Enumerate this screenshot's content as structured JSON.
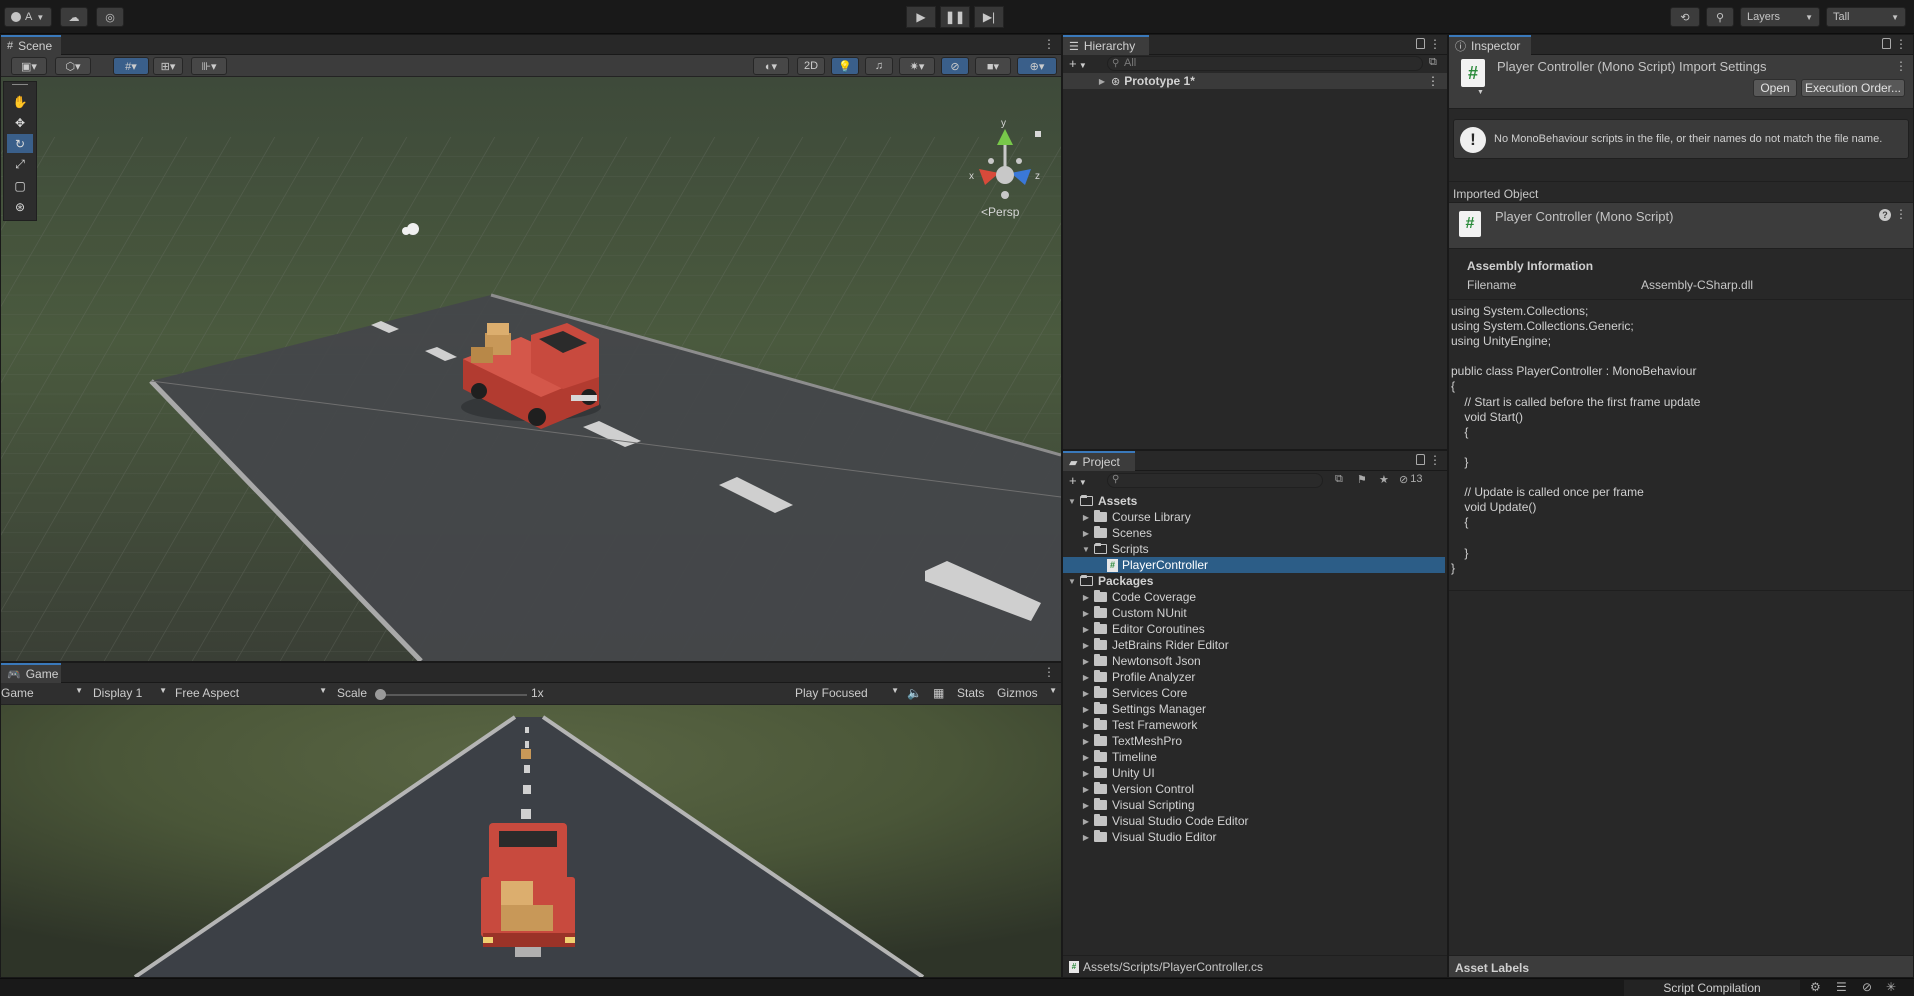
{
  "toolbar": {
    "account_label": "A",
    "layers_label": "Layers",
    "layout_label": "Tall"
  },
  "scene": {
    "tab_label": "Scene",
    "btn_2d": "2D",
    "persp_label": "Persp",
    "axis_x": "x",
    "axis_y": "y",
    "axis_z": "z"
  },
  "game": {
    "tab_label": "Game",
    "view_select": "Game",
    "display_select": "Display 1",
    "aspect_select": "Free Aspect",
    "scale_label": "Scale",
    "scale_value": "1x",
    "play_mode": "Play Focused",
    "stats_label": "Stats",
    "gizmos_label": "Gizmos"
  },
  "hierarchy": {
    "tab_label": "Hierarchy",
    "search_placeholder": "All",
    "items": [
      "Prototype 1*"
    ]
  },
  "project": {
    "tab_label": "Project",
    "hidden_count": "13",
    "root_assets": "Assets",
    "asset_folders": [
      "Course Library",
      "Scenes",
      "Scripts"
    ],
    "selected_item": "PlayerController",
    "root_packages": "Packages",
    "packages": [
      "Code Coverage",
      "Custom NUnit",
      "Editor Coroutines",
      "JetBrains Rider Editor",
      "Newtonsoft Json",
      "Profile Analyzer",
      "Services Core",
      "Settings Manager",
      "Test Framework",
      "TextMeshPro",
      "Timeline",
      "Unity UI",
      "Version Control",
      "Visual Scripting",
      "Visual Studio Code Editor",
      "Visual Studio Editor"
    ],
    "path": "Assets/Scripts/PlayerController.cs"
  },
  "inspector": {
    "tab_label": "Inspector",
    "title": "Player Controller (Mono Script) Import Settings",
    "open_button": "Open",
    "execution_order_button": "Execution Order...",
    "warning_text": "No MonoBehaviour scripts in the file, or their names do not match the file name.",
    "imported_object_label": "Imported Object",
    "object_name": "Player Controller (Mono Script)",
    "assembly_info_label": "Assembly Information",
    "filename_label": "Filename",
    "filename_value": "Assembly-CSharp.dll",
    "code_lines": [
      "using System.Collections;",
      "using System.Collections.Generic;",
      "using UnityEngine;",
      "",
      "public class PlayerController : MonoBehaviour",
      "{",
      "    // Start is called before the first frame update",
      "    void Start()",
      "    {",
      "",
      "    }",
      "",
      "    // Update is called once per frame",
      "    void Update()",
      "    {",
      "",
      "    }",
      "}"
    ],
    "asset_labels": "Asset Labels"
  },
  "statusbar": {
    "script_compilation": "Script Compilation"
  },
  "colors": {
    "selection": "#2c5d87",
    "tab_accent": "#3a79bb",
    "truck": "#c8463a",
    "crate": "#c89858"
  }
}
